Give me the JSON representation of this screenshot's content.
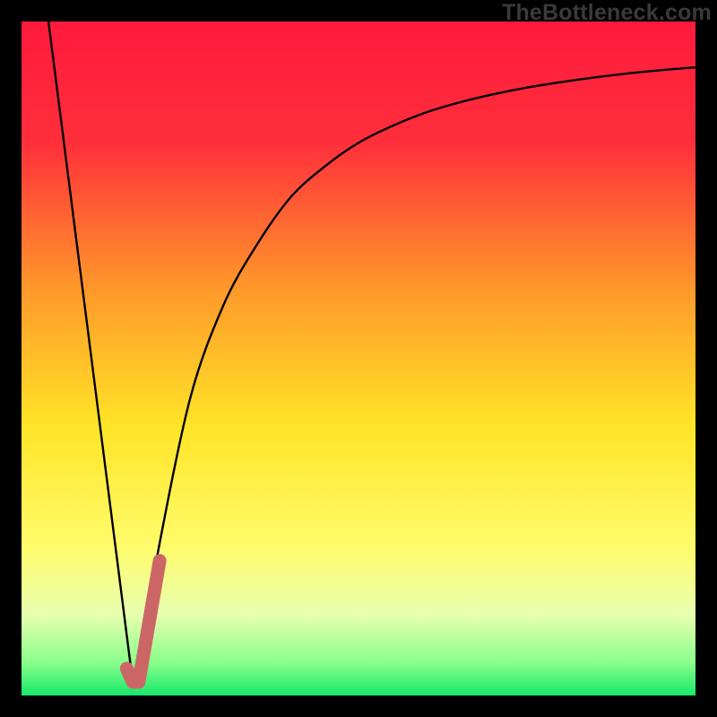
{
  "watermark": "TheBottleneck.com",
  "chart_data": {
    "type": "line",
    "title": "",
    "xlabel": "",
    "ylabel": "",
    "xlim": [
      0,
      100
    ],
    "ylim": [
      0,
      100
    ],
    "gradient_stops": [
      {
        "offset": 0,
        "color": "#ff1a3c"
      },
      {
        "offset": 18,
        "color": "#ff2f3b"
      },
      {
        "offset": 40,
        "color": "#ff9a2a"
      },
      {
        "offset": 60,
        "color": "#ffe427"
      },
      {
        "offset": 78,
        "color": "#fffc6b"
      },
      {
        "offset": 88,
        "color": "#e8ffb0"
      },
      {
        "offset": 95,
        "color": "#8bff8b"
      },
      {
        "offset": 100,
        "color": "#17e86b"
      }
    ],
    "series": [
      {
        "name": "left-falling-line",
        "x": [
          4,
          16.5
        ],
        "y": [
          100,
          2
        ]
      },
      {
        "name": "rising-curve",
        "x": [
          17,
          20,
          25,
          30,
          35,
          40,
          45,
          50,
          55,
          60,
          65,
          70,
          75,
          80,
          85,
          90,
          95,
          100
        ],
        "y": [
          2,
          20,
          44,
          58,
          67,
          74,
          78.5,
          82,
          84.5,
          86.5,
          88,
          89.2,
          90.2,
          91,
          91.7,
          92.3,
          92.8,
          93.2
        ]
      }
    ],
    "highlight_segment": {
      "name": "highlighted-j-segment",
      "color": "#cc6666",
      "points": [
        {
          "x": 15.6,
          "y": 4
        },
        {
          "x": 16.5,
          "y": 2
        },
        {
          "x": 17.4,
          "y": 2
        },
        {
          "x": 20.5,
          "y": 20
        }
      ]
    }
  }
}
